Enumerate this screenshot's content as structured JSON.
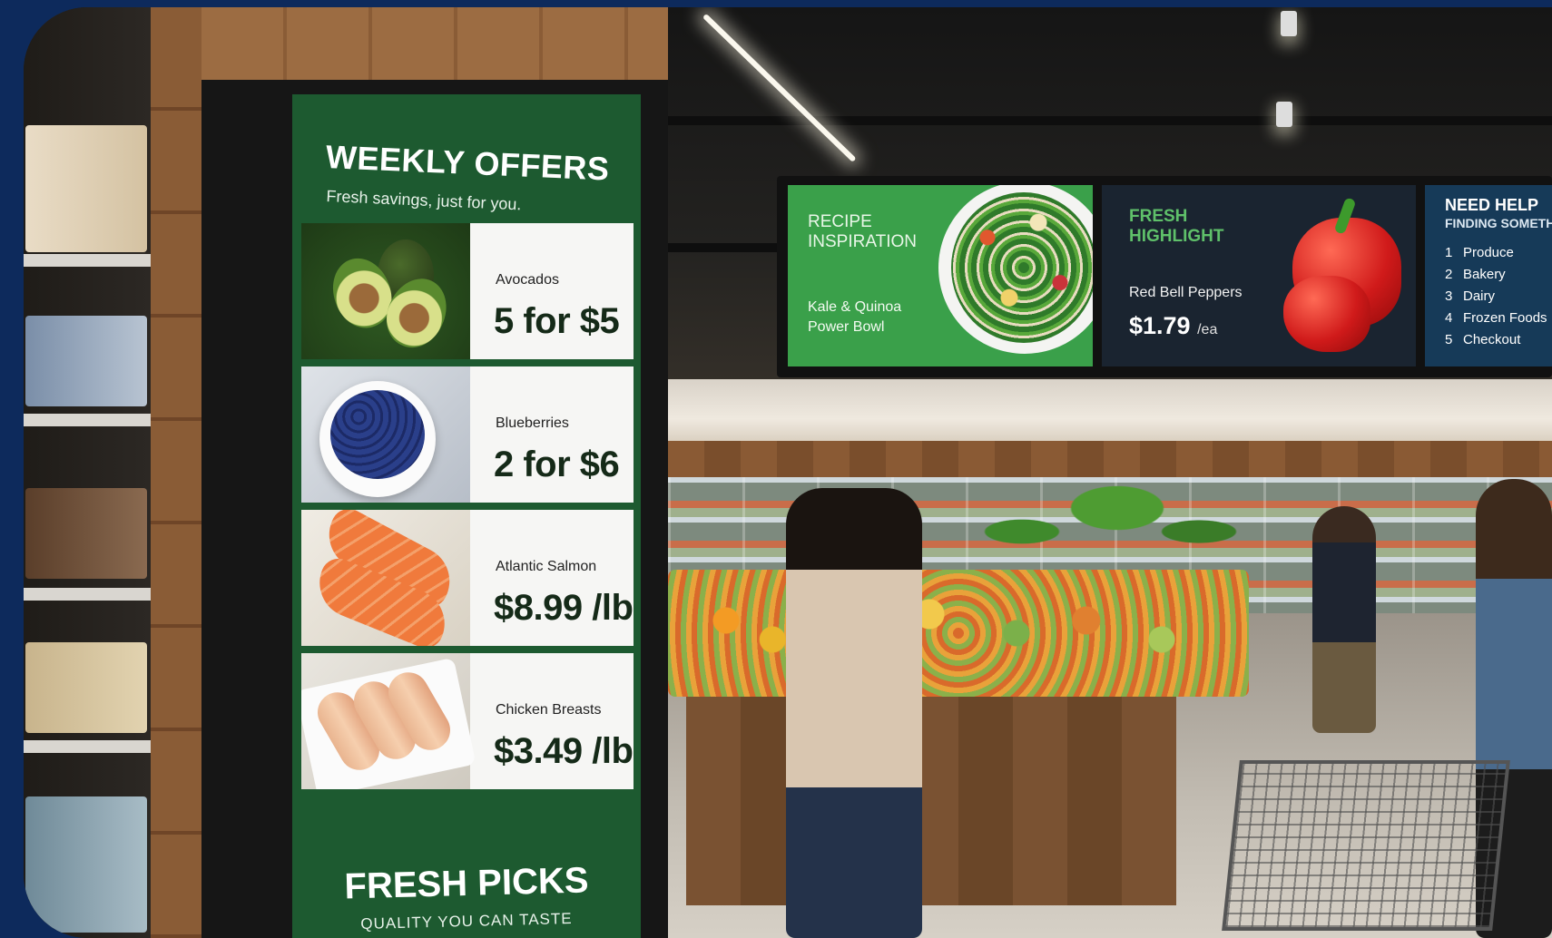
{
  "kiosk": {
    "title": "WEEKLY OFFERS",
    "subtitle": "Fresh savings, just for you.",
    "offers": [
      {
        "name": "Avocados",
        "price": "5 for $5",
        "icon": "avocado-icon"
      },
      {
        "name": "Blueberries",
        "price": "2 for $6",
        "icon": "blueberries-icon"
      },
      {
        "name": "Atlantic Salmon",
        "price": "$8.99 /lb",
        "icon": "salmon-icon"
      },
      {
        "name": "Chicken Breasts",
        "price": "$3.49 /lb",
        "icon": "chicken-icon"
      }
    ],
    "footer_title": "FRESH PICKS",
    "footer_subtitle": "QUALITY YOU CAN TASTE",
    "accent_color": "#1d5a30"
  },
  "signs": {
    "recipe": {
      "heading": "RECIPE INSPIRATION",
      "dish": "Kale & Quinoa Power Bowl",
      "icon": "salad-bowl-icon",
      "color": "#3aa04a"
    },
    "fresh": {
      "heading": "FRESH HIGHLIGHT",
      "item": "Red Bell Peppers",
      "price": "$1.79",
      "unit": "/ea",
      "icon": "red-pepper-icon",
      "color": "#1a2430"
    },
    "help": {
      "heading": "NEED HELP",
      "subheading": "FINDING SOMETH",
      "items": [
        {
          "num": "1",
          "label": "Produce"
        },
        {
          "num": "2",
          "label": "Bakery"
        },
        {
          "num": "3",
          "label": "Dairy"
        },
        {
          "num": "4",
          "label": "Frozen Foods"
        },
        {
          "num": "5",
          "label": "Checkout"
        }
      ],
      "color": "#163a58"
    }
  },
  "frame_color": "#0d2a5c"
}
